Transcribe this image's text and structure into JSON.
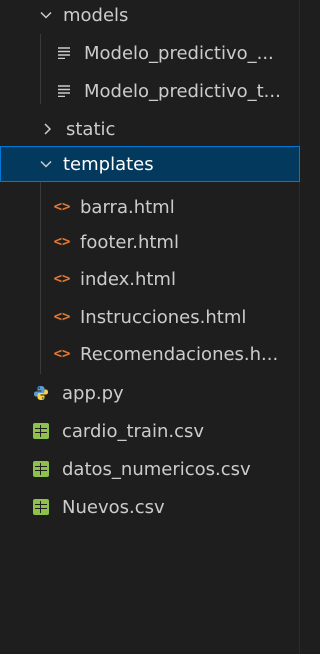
{
  "explorer": {
    "folders": {
      "models": "models",
      "static": "static",
      "templates": "templates"
    },
    "models_files": [
      "Modelo_predictivo_...",
      "Modelo_predictivo_t..."
    ],
    "templates_files": [
      "barra.html",
      "footer.html",
      "index.html",
      "Instrucciones.html",
      "Recomendaciones.h..."
    ],
    "root_files": [
      "app.py",
      "cardio_train.csv",
      "datos_numericos.csv",
      "Nuevos.csv"
    ],
    "icons": {
      "text_file": "text-lines-icon",
      "html_file": "code-angle-brackets-icon",
      "python_file": "python-icon",
      "csv_file": "table-icon"
    },
    "colors": {
      "background": "#1e1e1e",
      "selected_background": "#04395e",
      "selected_border": "#0078d4",
      "html_icon": "#e37933",
      "csv_icon": "#8dc149",
      "text": "#cccccc"
    }
  }
}
